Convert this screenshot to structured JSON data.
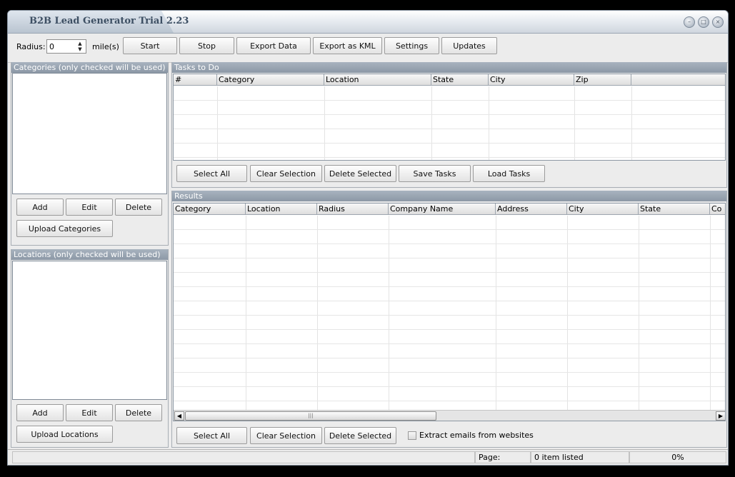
{
  "window": {
    "title": "B2B Lead Generator Trial 2.23",
    "minimize_glyph": "–",
    "maximize_glyph": "□",
    "close_glyph": "×"
  },
  "toolbar": {
    "radius_label": "Radius:",
    "radius_value": "0",
    "unit_label": "mile(s)",
    "start": "Start",
    "stop": "Stop",
    "export_data": "Export Data",
    "export_kml": "Export as KML",
    "settings": "Settings",
    "updates": "Updates"
  },
  "categories": {
    "header": "Categories (only checked will be used)",
    "add": "Add",
    "edit": "Edit",
    "delete": "Delete",
    "upload": "Upload Categories"
  },
  "locations": {
    "header": "Locations (only checked will be used)",
    "add": "Add",
    "edit": "Edit",
    "delete": "Delete",
    "upload": "Upload Locations"
  },
  "tasks": {
    "header": "Tasks to Do",
    "columns": [
      "#",
      "Category",
      "Location",
      "State",
      "City",
      "Zip"
    ],
    "select_all": "Select All",
    "clear_selection": "Clear Selection",
    "delete_selected": "Delete Selected",
    "save_tasks": "Save Tasks",
    "load_tasks": "Load Tasks"
  },
  "results": {
    "header": "Results",
    "columns": [
      "Category",
      "Location",
      "Radius",
      "Company Name",
      "Address",
      "City",
      "State",
      "Co"
    ],
    "select_all": "Select All",
    "clear_selection": "Clear Selection",
    "delete_selected": "Delete Selected",
    "extract_emails_label": "Extract emails from websites",
    "extract_emails_checked": false
  },
  "status": {
    "page_label": "Page:",
    "items_listed": "0 item listed",
    "progress": "0%"
  }
}
